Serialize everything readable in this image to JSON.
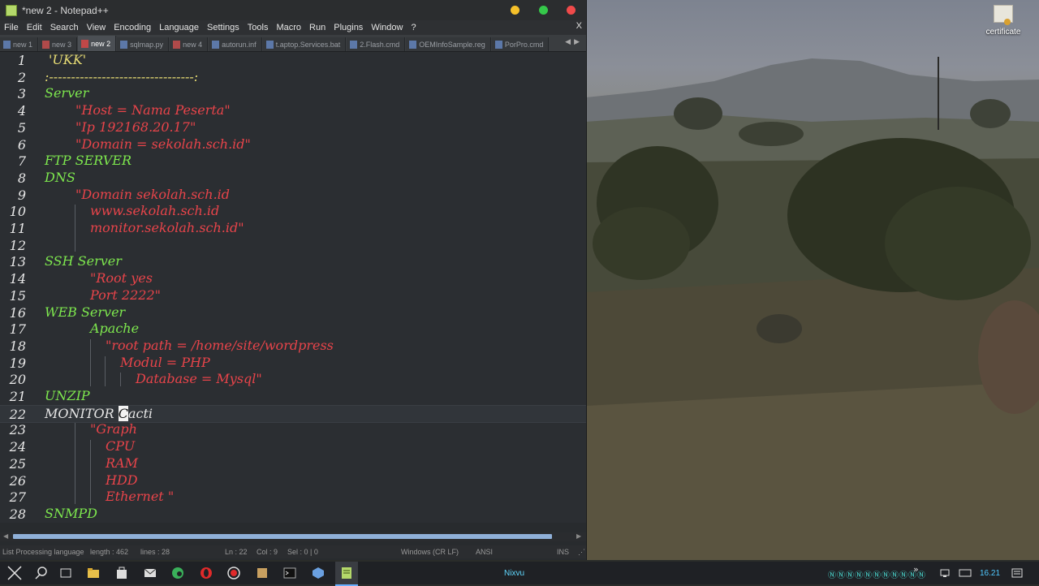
{
  "window": {
    "title": "*new 2 - Notepad++"
  },
  "menu": [
    "File",
    "Edit",
    "Search",
    "View",
    "Encoding",
    "Language",
    "Settings",
    "Tools",
    "Macro",
    "Run",
    "Plugins",
    "Window",
    "?"
  ],
  "menu_close": "X",
  "tabs": [
    {
      "label": "new 1",
      "state": "normal"
    },
    {
      "label": "new 3",
      "state": "mod"
    },
    {
      "label": "new 2",
      "state": "active"
    },
    {
      "label": "sqlmap.py",
      "state": "normal"
    },
    {
      "label": "new 4",
      "state": "mod"
    },
    {
      "label": "autorun.inf",
      "state": "normal"
    },
    {
      "label": "t.aptop.Services.bat",
      "state": "normal"
    },
    {
      "label": "2.Flash.cmd",
      "state": "normal"
    },
    {
      "label": "OEMInfoSample.reg",
      "state": "normal"
    },
    {
      "label": "PorPro.cmd",
      "state": "normal"
    }
  ],
  "lines": [
    {
      "n": "1",
      "text": "'UKK'",
      "color": "yellow",
      "indent": 60
    },
    {
      "n": "2",
      "text": ":---------------------------------:",
      "color": "yellow",
      "indent": 55
    },
    {
      "n": "3",
      "text": "Server",
      "color": "green",
      "indent": 55
    },
    {
      "n": "4",
      "text": "\"Host = Nama Peserta\"",
      "color": "red",
      "indent": 93
    },
    {
      "n": "5",
      "text": "\"Ip 192168.20.17\"",
      "color": "red",
      "indent": 93
    },
    {
      "n": "6",
      "text": "\"Domain = sekolah.sch.id\"",
      "color": "red",
      "indent": 93
    },
    {
      "n": "7",
      "text": "FTP SERVER",
      "color": "green",
      "indent": 55
    },
    {
      "n": "8",
      "text": "DNS",
      "color": "green",
      "indent": 55
    },
    {
      "n": "9",
      "text": "\"Domain sekolah.sch.id",
      "color": "red",
      "indent": 93
    },
    {
      "n": "10",
      "text": "www.sekolah.sch.id",
      "color": "red",
      "indent": 111
    },
    {
      "n": "11",
      "text": "monitor.sekolah.sch.id\"",
      "color": "red",
      "indent": 111
    },
    {
      "n": "12",
      "text": "",
      "color": "red",
      "indent": 111
    },
    {
      "n": "13",
      "text": "SSH Server",
      "color": "green",
      "indent": 55
    },
    {
      "n": "14",
      "text": "\"Root yes",
      "color": "red",
      "indent": 111
    },
    {
      "n": "15",
      "text": "Port 2222\"",
      "color": "red",
      "indent": 111
    },
    {
      "n": "16",
      "text": "WEB Server",
      "color": "green",
      "indent": 55
    },
    {
      "n": "17",
      "text": "Apache",
      "color": "green",
      "indent": 111
    },
    {
      "n": "18",
      "text": "\"root path = /home/site/wordpress",
      "color": "red",
      "indent": 130
    },
    {
      "n": "19",
      "text": "Modul = PHP",
      "color": "red",
      "indent": 148
    },
    {
      "n": "20",
      "text": "Database = Mysql\"",
      "color": "red",
      "indent": 167
    },
    {
      "n": "21",
      "text": "UNZIP",
      "color": "green",
      "indent": 55
    },
    {
      "n": "22",
      "text": "MONITOR Cacti",
      "color": "white",
      "indent": 55,
      "current": true
    },
    {
      "n": "23",
      "text": "\"Graph",
      "color": "red",
      "indent": 111
    },
    {
      "n": "24",
      "text": "CPU",
      "color": "red",
      "indent": 130
    },
    {
      "n": "25",
      "text": "RAM",
      "color": "red",
      "indent": 130
    },
    {
      "n": "26",
      "text": "HDD",
      "color": "red",
      "indent": 130
    },
    {
      "n": "27",
      "text": "Ethernet \"",
      "color": "red",
      "indent": 130
    },
    {
      "n": "28",
      "text": "SNMPD",
      "color": "green",
      "indent": 55
    }
  ],
  "current_line": {
    "before": "MONITOR ",
    "cursor_char": "C",
    "after": "acti"
  },
  "status": {
    "language": "List Processing language",
    "length": "length : 462",
    "lines": "lines : 28",
    "position": "Ln : 22",
    "col": "Col : 9",
    "sel": "Sel : 0 | 0",
    "eol": "Windows (CR LF)",
    "encoding": "ANSI",
    "mode": "INS"
  },
  "desktop_icon": {
    "label": "certificate"
  },
  "taskbar": {
    "user": "Nixvu",
    "clock": "16.21",
    "tray_glyphs": "ⓃⓃⓃⓃⓃⓃⓃⓃⓃⓃⓃ",
    "more": "»"
  },
  "colors": {
    "yellow": "#e6db74",
    "green": "#7ee84e",
    "red": "#e8444a",
    "white": "#e6e6e6",
    "editor_bg": "#2b2e32"
  }
}
